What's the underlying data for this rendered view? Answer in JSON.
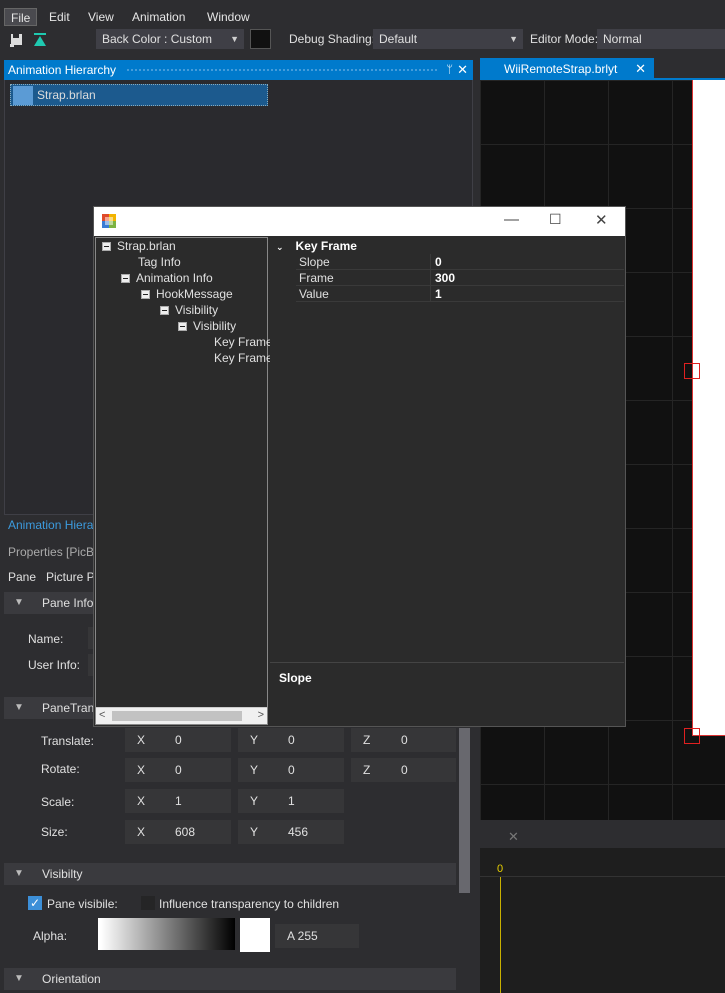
{
  "menu": {
    "items": [
      "File",
      "Edit",
      "View",
      "Animation",
      "Window"
    ]
  },
  "toolbar": {
    "back_color": "Back Color : Custom",
    "debug_label": "Debug Shading:",
    "debug_value": "Default",
    "editor_label": "Editor Mode:",
    "editor_value": "Normal"
  },
  "hierarchy": {
    "title": "Animation Hierarchy",
    "item": "Strap.brlan",
    "tab_label": "Animation Hiera"
  },
  "properties": {
    "title": "Properties [PicBo",
    "tabs": [
      "Pane",
      "Picture P"
    ],
    "sec_pane_info": "Pane Info",
    "name_label": "Name:",
    "userinfo_label": "User Info:",
    "sec_transform": "PaneTrans",
    "translate_label": "Translate:",
    "rotate_label": "Rotate:",
    "scale_label": "Scale:",
    "size_label": "Size:",
    "translate": [
      "0",
      "0",
      "0"
    ],
    "rotate": [
      "0",
      "0",
      "0"
    ],
    "scale": [
      "1",
      "1"
    ],
    "size": [
      "608",
      "456"
    ],
    "sec_visibility": "Visibilty",
    "pane_visible": "Pane visibile:",
    "influence": "Influence transparency to children",
    "alpha_label": "Alpha:",
    "alpha_value": "A  255",
    "sec_orientation": "Orientation"
  },
  "document": {
    "tab": "WiiRemoteStrap.brlyt"
  },
  "timeline": {
    "marker": "0"
  },
  "dialog": {
    "tree": {
      "root": "Strap.brlan",
      "tag": "Tag Info",
      "anim": "Animation Info",
      "hook": "HookMessage",
      "vis1": "Visibility",
      "vis2": "Visibility",
      "kf1": "Key Frame",
      "kf2": "Key Frame"
    },
    "grid": {
      "section": "Key Frame",
      "rows": [
        {
          "k": "Slope",
          "v": "0"
        },
        {
          "k": "Frame",
          "v": "300"
        },
        {
          "k": "Value",
          "v": "1"
        }
      ],
      "desc": "Slope"
    }
  },
  "colors": {
    "accent": "#007acc",
    "canvas_outline": "#e02020"
  }
}
